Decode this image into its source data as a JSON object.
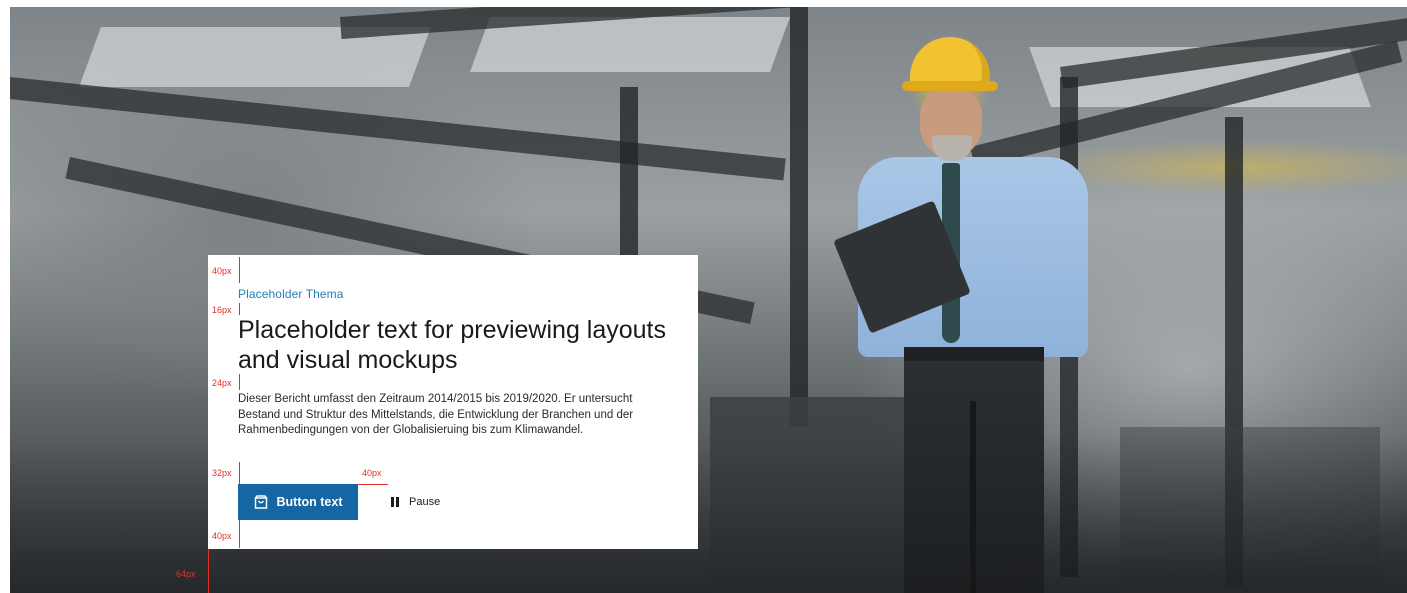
{
  "card": {
    "eyebrow": "Placeholder Thema",
    "headline": "Placeholder text for previewing layouts and visual mockups",
    "body": "Dieser Bericht umfasst den Zeitraum 2014/2015 bis 2019/2020. Er untersucht Bestand und Struktur des Mittelstands, die Entwicklung der Branchen und der Rahmenbedingungen von der Globalisieruing bis zum Klimawandel.",
    "primary_button": {
      "label": "Button text",
      "icon": "shopping-bag-icon"
    },
    "pause_button": {
      "label": "Pause",
      "icon": "pause-icon"
    }
  },
  "spacing_annotations": {
    "top_padding": "40px",
    "eyebrow_gap": "16px",
    "headline_gap": "24px",
    "body_gap": "32px",
    "button_gap": "40px",
    "bottom_padding": "40px",
    "card_offset": "64px"
  },
  "colors": {
    "accent": "#1f7fb8",
    "button_bg": "#1566a3",
    "annotation": "#e0302a",
    "helmet": "#f2c230"
  }
}
